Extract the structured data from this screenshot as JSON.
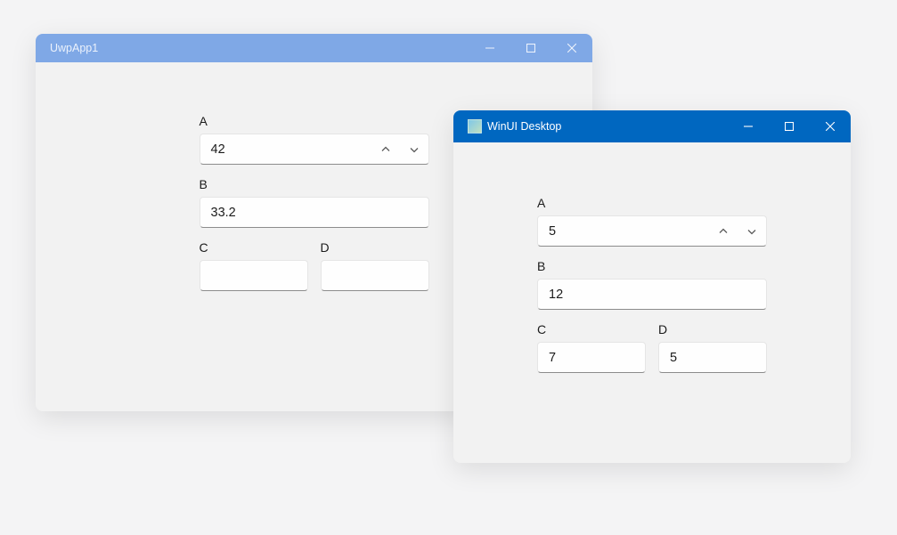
{
  "windows": {
    "back": {
      "title": "UwpApp1",
      "fields": {
        "a_label": "A",
        "a_value": "42",
        "b_label": "B",
        "b_value": "33.2",
        "c_label": "C",
        "c_value": "",
        "d_label": "D",
        "d_value": ""
      }
    },
    "front": {
      "title": "WinUI Desktop",
      "fields": {
        "a_label": "A",
        "a_value": "5",
        "b_label": "B",
        "b_value": "12",
        "c_label": "C",
        "c_value": "7",
        "d_label": "D",
        "d_value": "5"
      }
    }
  }
}
